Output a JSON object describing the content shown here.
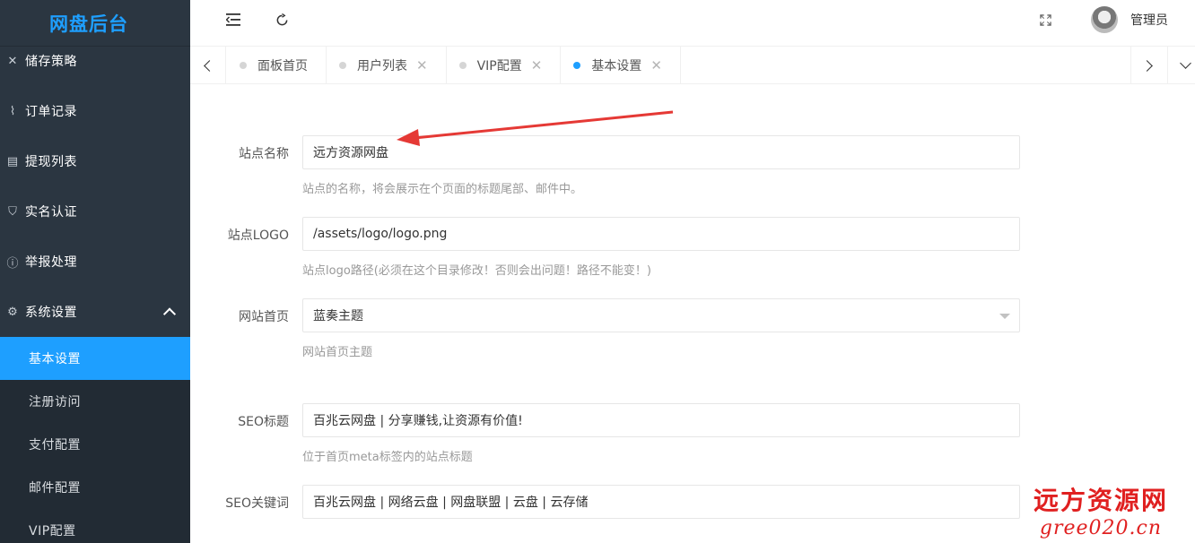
{
  "app_title": "网盘后台",
  "sidebar": {
    "items": [
      {
        "label": "储存策略",
        "icon": "tools-icon"
      },
      {
        "label": "订单记录",
        "icon": "pulse-icon"
      },
      {
        "label": "提现列表",
        "icon": "document-icon"
      },
      {
        "label": "实名认证",
        "icon": "shield-icon"
      },
      {
        "label": "举报处理",
        "icon": "info-icon"
      },
      {
        "label": "系统设置",
        "icon": "gear-icon"
      }
    ],
    "sub_items": [
      {
        "label": "基本设置",
        "active": true
      },
      {
        "label": "注册访问"
      },
      {
        "label": "支付配置"
      },
      {
        "label": "邮件配置"
      },
      {
        "label": "VIP配置"
      }
    ]
  },
  "header": {
    "user_name": "管理员"
  },
  "tabs": [
    {
      "label": "面板首页",
      "closable": false
    },
    {
      "label": "用户列表",
      "closable": true
    },
    {
      "label": "VIP配置",
      "closable": true
    },
    {
      "label": "基本设置",
      "closable": true,
      "active": true
    }
  ],
  "form": {
    "site_name": {
      "label": "站点名称",
      "value": "远方资源网盘",
      "help": "站点的名称，将会展示在个页面的标题尾部、邮件中。"
    },
    "site_logo": {
      "label": "站点LOGO",
      "value": "/assets/logo/logo.png",
      "help": "站点logo路径(必须在这个目录修改！否则会出问题！路径不能变！)"
    },
    "home_page": {
      "label": "网站首页",
      "value": "蓝奏主题",
      "help": "网站首页主题"
    },
    "seo_title": {
      "label": "SEO标题",
      "value": "百兆云网盘 | 分享赚钱,让资源有价值!",
      "help": "位于首页meta标签内的站点标题"
    },
    "seo_keywords": {
      "label": "SEO关键词",
      "value": "百兆云网盘 | 网络云盘 | 网盘联盟 | 云盘 | 云存储"
    }
  },
  "watermark": {
    "line1": "远方资源网",
    "line2": "gree020.cn"
  },
  "colors": {
    "accent": "#1e9fff",
    "sidebar_bg": "#2b3641",
    "annotation": "#e53935"
  }
}
